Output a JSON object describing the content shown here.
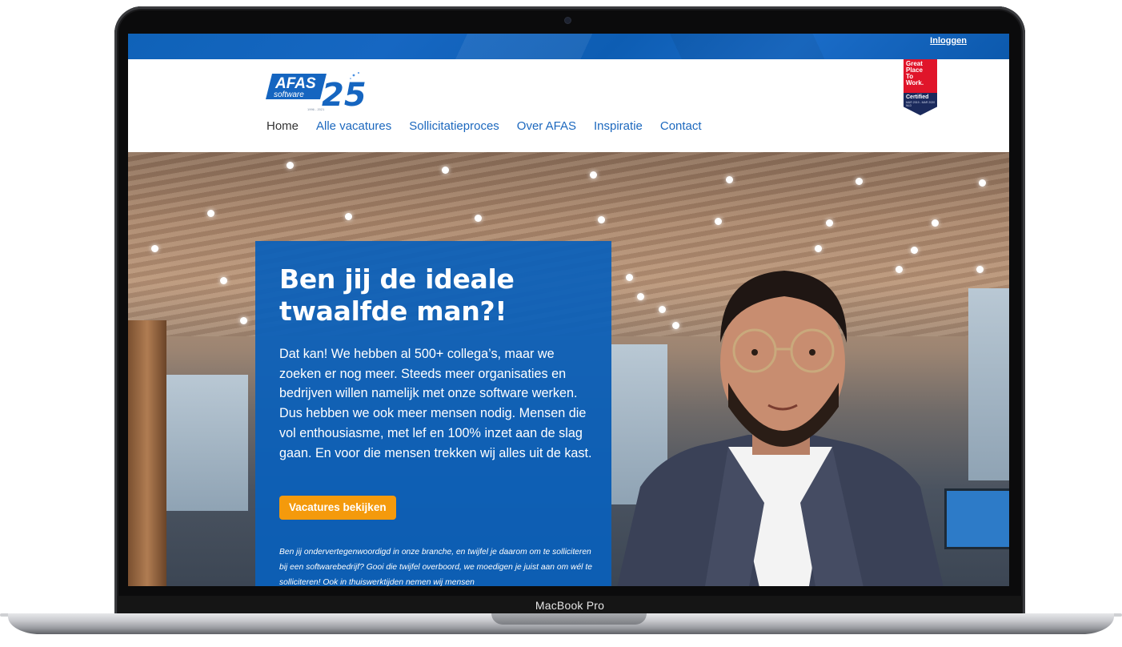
{
  "device": {
    "label": "MacBook Pro"
  },
  "topbar": {
    "login_label": "Inloggen"
  },
  "logo": {
    "brand": "AFAS",
    "sub": "software",
    "anniversary": "25",
    "years": "1996 - 2021"
  },
  "nav": {
    "items": [
      {
        "label": "Home"
      },
      {
        "label": "Alle vacatures"
      },
      {
        "label": "Sollicitatieproces"
      },
      {
        "label": "Over AFAS"
      },
      {
        "label": "Inspiratie"
      },
      {
        "label": "Contact"
      }
    ]
  },
  "badge": {
    "line1": "Great",
    "line2": "Place",
    "line3": "To",
    "line4": "Work.",
    "certified": "Certified",
    "years": "MAR 2019 - MAR 2020 NLD"
  },
  "hero": {
    "title": "Ben jij de ideale twaalfde man?!",
    "body": "Dat kan! We hebben al 500+ collega’s, maar we zoeken er nog meer. Steeds meer organisaties en bedrijven willen namelijk met onze software werken. Dus hebben we ook meer mensen nodig. Mensen die vol enthousiasme, met lef en 100% inzet aan de slag gaan. En voor die mensen trekken wij alles uit de kast.",
    "cta_label": "Vacatures bekijken",
    "note": "Ben jij ondervertegenwoordigd in onze branche, en twijfel je daarom om te solliciteren bij een softwarebedrijf? Gooi die twijfel overboord, we moedigen je juist aan om wél te solliciteren! Ook in thuiswerktijden nemen wij mensen"
  },
  "colors": {
    "brand_blue": "#0a60ba",
    "cta_orange": "#f49a0c",
    "badge_red": "#e0152a",
    "badge_navy": "#1b2a5c"
  }
}
